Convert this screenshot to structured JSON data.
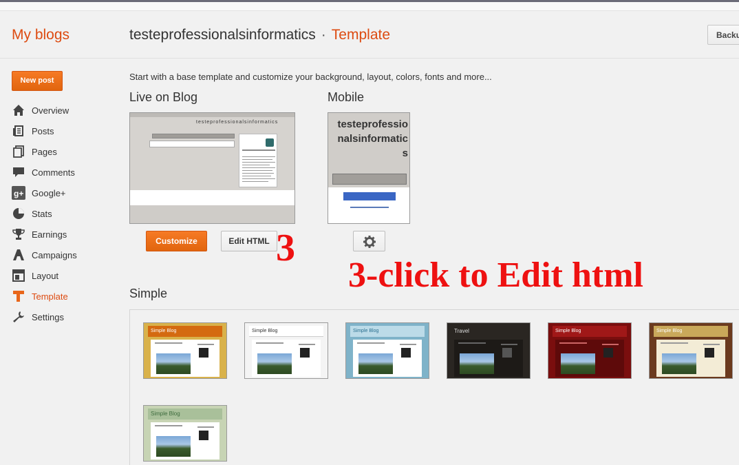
{
  "header": {
    "my_blogs": "My blogs",
    "blog_name": "testeprofessionalsinformatics",
    "separator": "·",
    "current_page": "Template",
    "backup_label": "Backu"
  },
  "sidebar": {
    "new_post": "New post",
    "items": [
      {
        "label": "Overview",
        "icon": "home-icon"
      },
      {
        "label": "Posts",
        "icon": "posts-icon"
      },
      {
        "label": "Pages",
        "icon": "pages-icon"
      },
      {
        "label": "Comments",
        "icon": "comment-icon"
      },
      {
        "label": "Google+",
        "icon": "google-plus-icon"
      },
      {
        "label": "Stats",
        "icon": "pie-chart-icon"
      },
      {
        "label": "Earnings",
        "icon": "trophy-icon"
      },
      {
        "label": "Campaigns",
        "icon": "campaigns-icon"
      },
      {
        "label": "Layout",
        "icon": "layout-icon"
      },
      {
        "label": "Template",
        "icon": "template-icon",
        "active": true
      },
      {
        "label": "Settings",
        "icon": "wrench-icon"
      }
    ]
  },
  "main": {
    "intro": "Start with a base template and customize your background, layout, colors, fonts and more...",
    "live_on_blog": "Live on Blog",
    "mobile": "Mobile",
    "live_preview_title": "testeprofessionalsinformatics",
    "mobile_preview_title": "testeprofessionalsinformatics",
    "customize_label": "Customize",
    "edit_html_label": "Edit HTML",
    "simple": "Simple",
    "themes": [
      {
        "title": "Simple Blog",
        "scheme": "orange"
      },
      {
        "title": "Simple Blog",
        "scheme": "white"
      },
      {
        "title": "Simple Blog",
        "scheme": "blue"
      },
      {
        "title": "Travel",
        "scheme": "dark"
      },
      {
        "title": "Simple Blog",
        "scheme": "red"
      },
      {
        "title": "Simple Blog",
        "scheme": "tan"
      },
      {
        "title": "Simple Blog",
        "scheme": "green"
      }
    ]
  },
  "annotations": {
    "step_number": "3",
    "instruction": "3-click to Edit html"
  },
  "colors": {
    "accent": "#dd4b11",
    "annotation": "#ee1111"
  }
}
